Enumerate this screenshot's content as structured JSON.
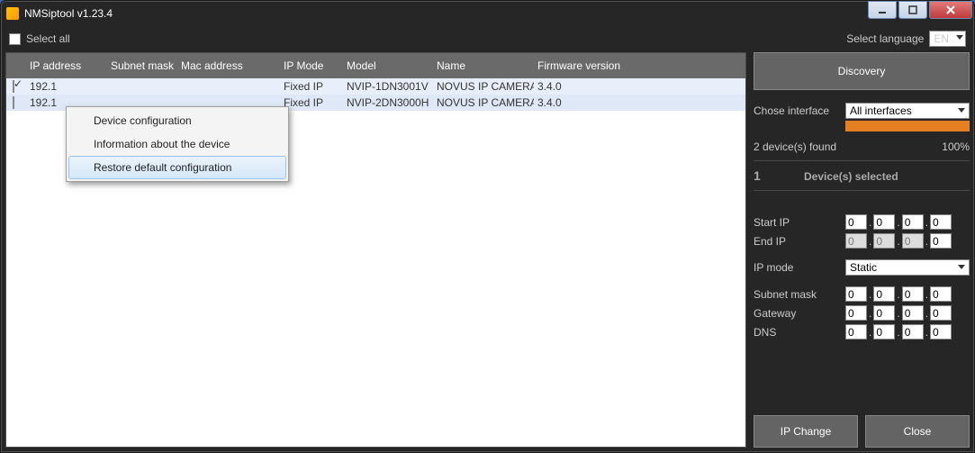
{
  "window": {
    "title": "NMSiptool v1.23.4"
  },
  "topbar": {
    "select_all": "Select all",
    "select_language": "Select language",
    "lang": "EN"
  },
  "columns": {
    "ip": "IP address",
    "subnet": "Subnet mask",
    "mac": "Mac address",
    "mode": "IP Mode",
    "model": "Model",
    "name": "Name",
    "fw": "Firmware version"
  },
  "rows": [
    {
      "checked": true,
      "ip": "192.1",
      "subnet": "",
      "mac": "",
      "mode": "Fixed IP",
      "model": "NVIP-1DN3001V",
      "name": "NOVUS IP CAMERA",
      "fw": "3.4.0"
    },
    {
      "checked": false,
      "ip": "192.1",
      "subnet": "",
      "mac": "",
      "mode": "Fixed IP",
      "model": "NVIP-2DN3000H",
      "name": "NOVUS IP CAMERA",
      "fw": "3.4.0"
    }
  ],
  "context_menu": {
    "items": [
      "Device configuration",
      "Information about the device",
      "Restore default configuration"
    ],
    "hover_index": 2
  },
  "sidebar": {
    "discovery": "Discovery",
    "chose_interface": "Chose interface",
    "interface_value": "All interfaces",
    "found": "2 device(s) found",
    "pct": "100%",
    "selected_num": "1",
    "selected_label": "Device(s) selected",
    "start_ip": "Start IP",
    "end_ip": "End IP",
    "ip_mode_lbl": "IP mode",
    "ip_mode_val": "Static",
    "subnet_lbl": "Subnet mask",
    "gateway_lbl": "Gateway",
    "dns_lbl": "DNS",
    "ip_change": "IP Change",
    "close": "Close",
    "o": "0"
  }
}
